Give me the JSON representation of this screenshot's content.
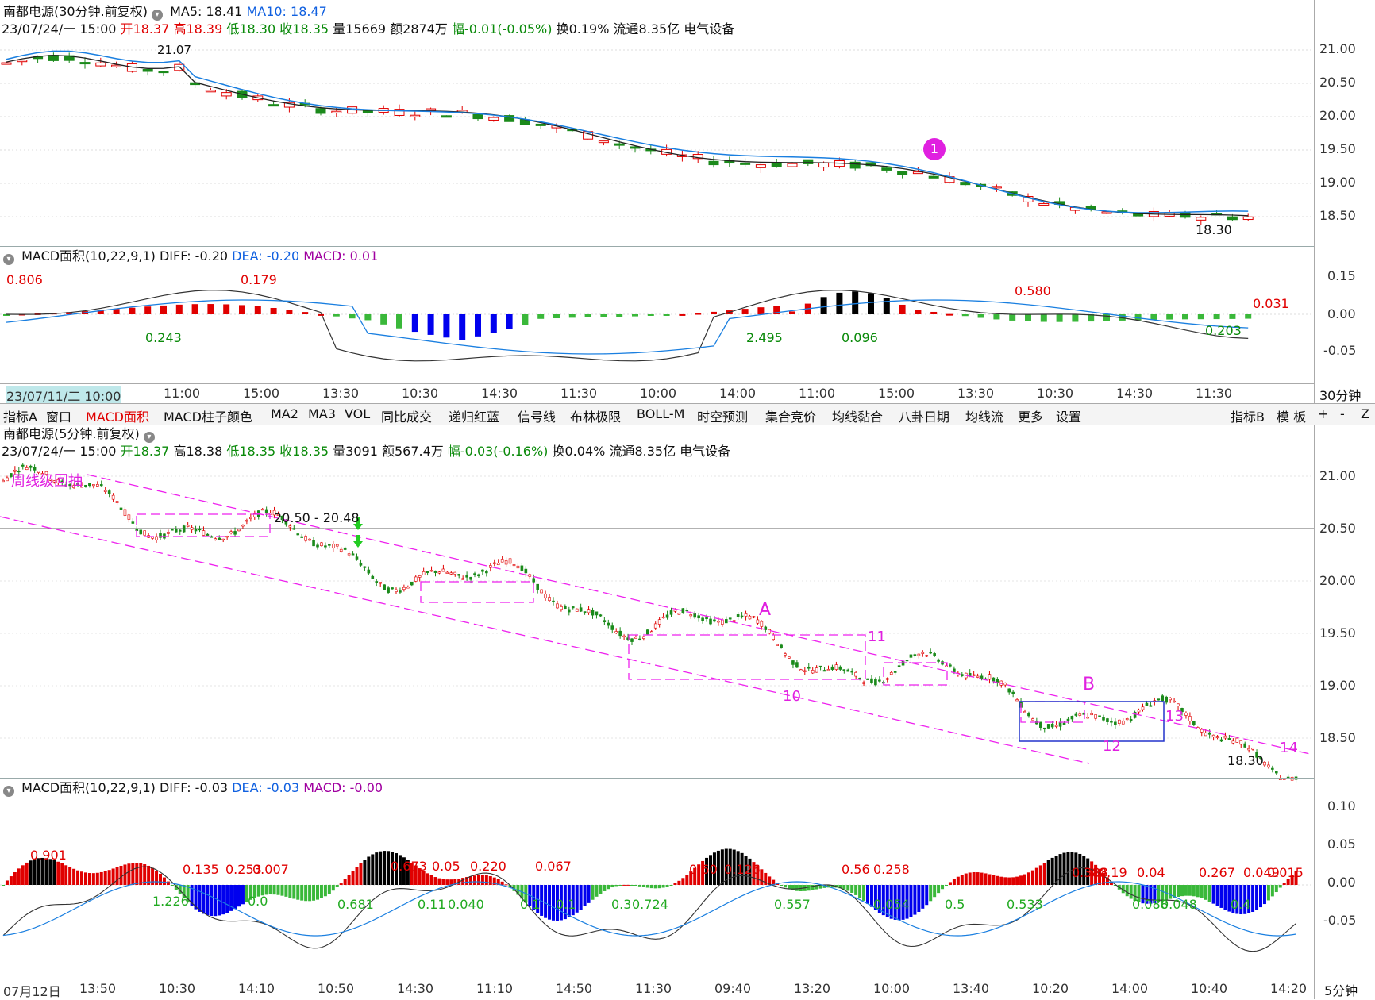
{
  "top_chart": {
    "title": "南都电源(30分钟.前复权)",
    "ma5_label": "MA5: 18.41",
    "ma10_label": "MA10: 18.47",
    "date": "23/07/24/一 15:00",
    "open_label": "开18.37",
    "high_label": "高18.39",
    "low_label": "低18.30",
    "close_label": "收18.35",
    "vol_label": "量15669",
    "amt_label": "额2874万",
    "change_label": "幅-0.01(-0.05%)",
    "turnover_label": "换0.19%",
    "float_label": "流通8.35亿",
    "sector_label": "电气设备",
    "y_ticks": [
      "21.00",
      "20.50",
      "20.00",
      "19.50",
      "19.00",
      "18.50"
    ],
    "peak_label": "21.07",
    "low_marker": "18.30",
    "circle_marker": "1"
  },
  "top_macd": {
    "title": "MACD面积(10,22,9,1)",
    "diff_label": "DIFF: -0.20",
    "dea_label": "DEA: -0.20",
    "macd_label": "MACD: 0.01",
    "y_ticks": [
      "0.15",
      "0.00",
      "-0.05"
    ],
    "annotations": [
      "0.806",
      "0.179",
      "0.243",
      "2.495",
      "0.096",
      "0.580",
      "0.031",
      "0.203"
    ]
  },
  "top_xaxis": {
    "labels": [
      "23/07/11/二 10:00",
      "11:00",
      "15:00",
      "13:30",
      "10:30",
      "14:30",
      "11:30",
      "10:00",
      "14:00",
      "11:00",
      "15:00",
      "13:30",
      "10:30",
      "14:30",
      "11:30"
    ],
    "period": "30分钟"
  },
  "toolbar": {
    "items": [
      "指标A",
      "窗口",
      "MACD面积",
      "MACD柱子颜色",
      "MA2",
      "MA3",
      "VOL",
      "同比成交",
      "递归红蓝",
      "信号线",
      "布林极限",
      "BOLL-M",
      "时空预测",
      "集合竞价",
      "均线黏合",
      "八卦日期",
      "均线流",
      "更多",
      "设置"
    ],
    "right_items": [
      "指标B",
      "模 板",
      "+",
      "-",
      "Z"
    ]
  },
  "bottom_chart": {
    "title": "南都电源(5分钟.前复权)",
    "date": "23/07/24/一 15:00",
    "open_label": "开18.37",
    "high_label": "高18.38",
    "low_label": "低18.35",
    "close_label": "收18.35",
    "vol_label": "量3091",
    "amt_label": "额567.4万",
    "change_label": "幅-0.03(-0.16%)",
    "turnover_label": "换0.04%",
    "float_label": "流通8.35亿",
    "sector_label": "电气设备",
    "y_ticks": [
      "21.00",
      "20.50",
      "20.00",
      "19.50",
      "19.00",
      "18.50"
    ],
    "range_label": "20.50 - 20.48",
    "annotations": [
      "A",
      "B",
      "10",
      "11",
      "12",
      "13",
      "14"
    ],
    "low_marker": "18.30",
    "corner_text": "周线级回抽"
  },
  "bottom_macd": {
    "title": "MACD面积(10,22,9,1)",
    "diff_label": "DIFF: -0.03",
    "dea_label": "DEA: -0.03",
    "macd_label": "MACD: -0.00",
    "y_ticks": [
      "0.10",
      "0.05",
      "0.00",
      "-0.05"
    ],
    "annotations": [
      "0.901",
      "0.135",
      "0.253",
      "0.007",
      "0.673",
      "0.05",
      "0.220",
      "0.067",
      "0.60",
      "0.126",
      "0.56",
      "0.258",
      "0.388",
      "0.19",
      "0.04",
      "0.267",
      "0.049",
      "0.015",
      "1.226",
      "0.0",
      "0.681",
      "0.11",
      "0.040",
      "0.1",
      "0.1",
      "0.3",
      "0.724",
      "0.557",
      "0.054",
      "0.5",
      "0.533",
      "0.088",
      "0.048",
      "0.4"
    ]
  },
  "bottom_xaxis": {
    "labels": [
      "07月12日",
      "13:50",
      "10:30",
      "14:10",
      "10:50",
      "14:30",
      "11:10",
      "14:50",
      "11:30",
      "09:40",
      "13:20",
      "10:00",
      "13:40",
      "10:20",
      "14:00",
      "10:40",
      "14:20"
    ],
    "period": "5分钟"
  },
  "colors": {
    "up": "#e00000",
    "down": "#22aa22",
    "ma5": "#222222",
    "ma10": "#1a7fe0",
    "macd_blue": "#0000ee",
    "magenta": "#ee22ee"
  }
}
